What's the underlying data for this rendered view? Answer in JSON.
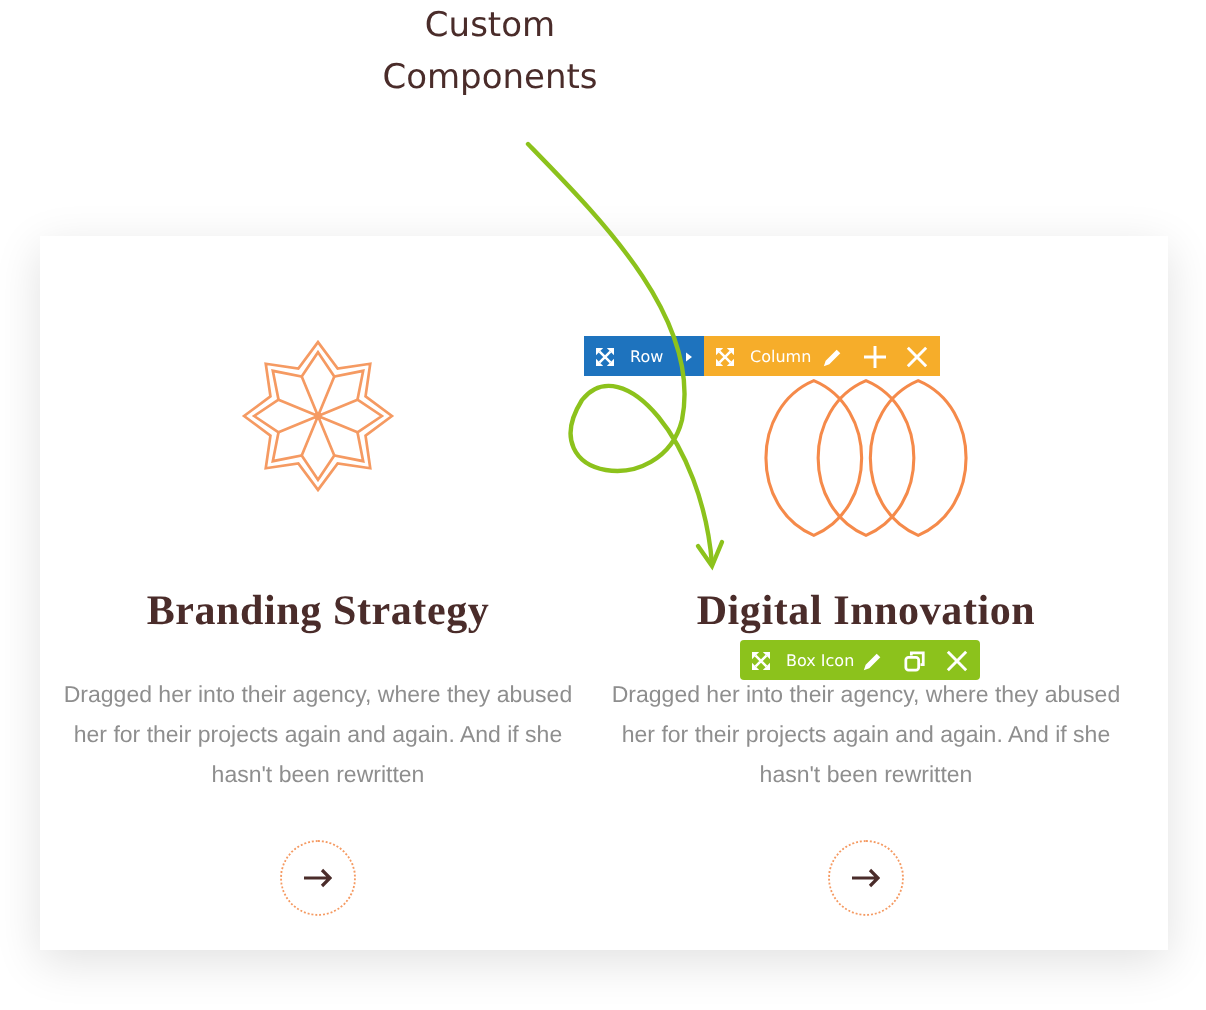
{
  "annotation": {
    "lines": [
      "Custom",
      "Components"
    ]
  },
  "features": [
    {
      "kind": "star",
      "title": "Branding Strategy",
      "text": "Dragged her into their agency, where they abused her for their projects again and again. And if she hasn't been rewritten"
    },
    {
      "kind": "rings",
      "title": "Digital Innovation",
      "text": "Dragged her into their agency, where they abused her for their projects again and again. And if she hasn't been rewritten"
    }
  ],
  "toolbars": {
    "row": {
      "label": "Row"
    },
    "column": {
      "label": "Column"
    },
    "box_icon": {
      "label": "Box Icon"
    }
  }
}
